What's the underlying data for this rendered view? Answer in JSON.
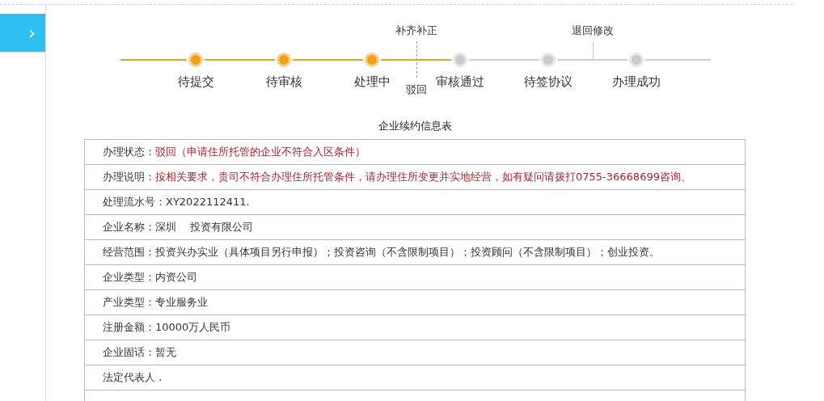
{
  "sidebar": {
    "button": {
      "icon": "›"
    }
  },
  "steps": [
    {
      "label": "待提交",
      "done": true
    },
    {
      "label": "待审核",
      "done": true
    },
    {
      "label": "处理中",
      "done": true,
      "branch": {
        "label": "补齐补正",
        "kind": "dashed",
        "return_label": "驳回"
      }
    },
    {
      "label": "审核通过",
      "done": false
    },
    {
      "label": "待签协议",
      "done": false,
      "branch": {
        "label": "退回修改",
        "kind": "solid"
      }
    },
    {
      "label": "办理成功",
      "done": false
    }
  ],
  "table": {
    "title": "企业续约信息表",
    "rows": [
      {
        "label": "办理状态：",
        "value": "驳回（申请住所托管的企业不符合入区条件）",
        "highlight": true
      },
      {
        "label": "办理说明：",
        "value": "按相关要求，贵司不符合办理住所托管条件，请办理住所变更并实地经营，如有疑问请拨打0755-36668699咨询。",
        "highlight": true
      },
      {
        "label": "处理流水号：",
        "value": "XY2022112411.",
        "highlight": false
      },
      {
        "label": "企业名称：",
        "value": "深圳    投资有限公司",
        "highlight": false
      },
      {
        "label": "经营范围：",
        "value": "投资兴办实业（具体项目另行申报）；投资咨询（不含限制项目）；投资顾问（不含限制项目）；创业投资。",
        "highlight": false
      },
      {
        "label": "企业类型：",
        "value": "内资公司",
        "highlight": false
      },
      {
        "label": "产业类型：",
        "value": "专业服务业",
        "highlight": false
      },
      {
        "label": "注册金额：",
        "value": "10000万人民币",
        "highlight": false
      },
      {
        "label": "企业固话：",
        "value": "暂无",
        "highlight": false
      },
      {
        "label": "法定代表人 ."
      }
    ]
  }
}
